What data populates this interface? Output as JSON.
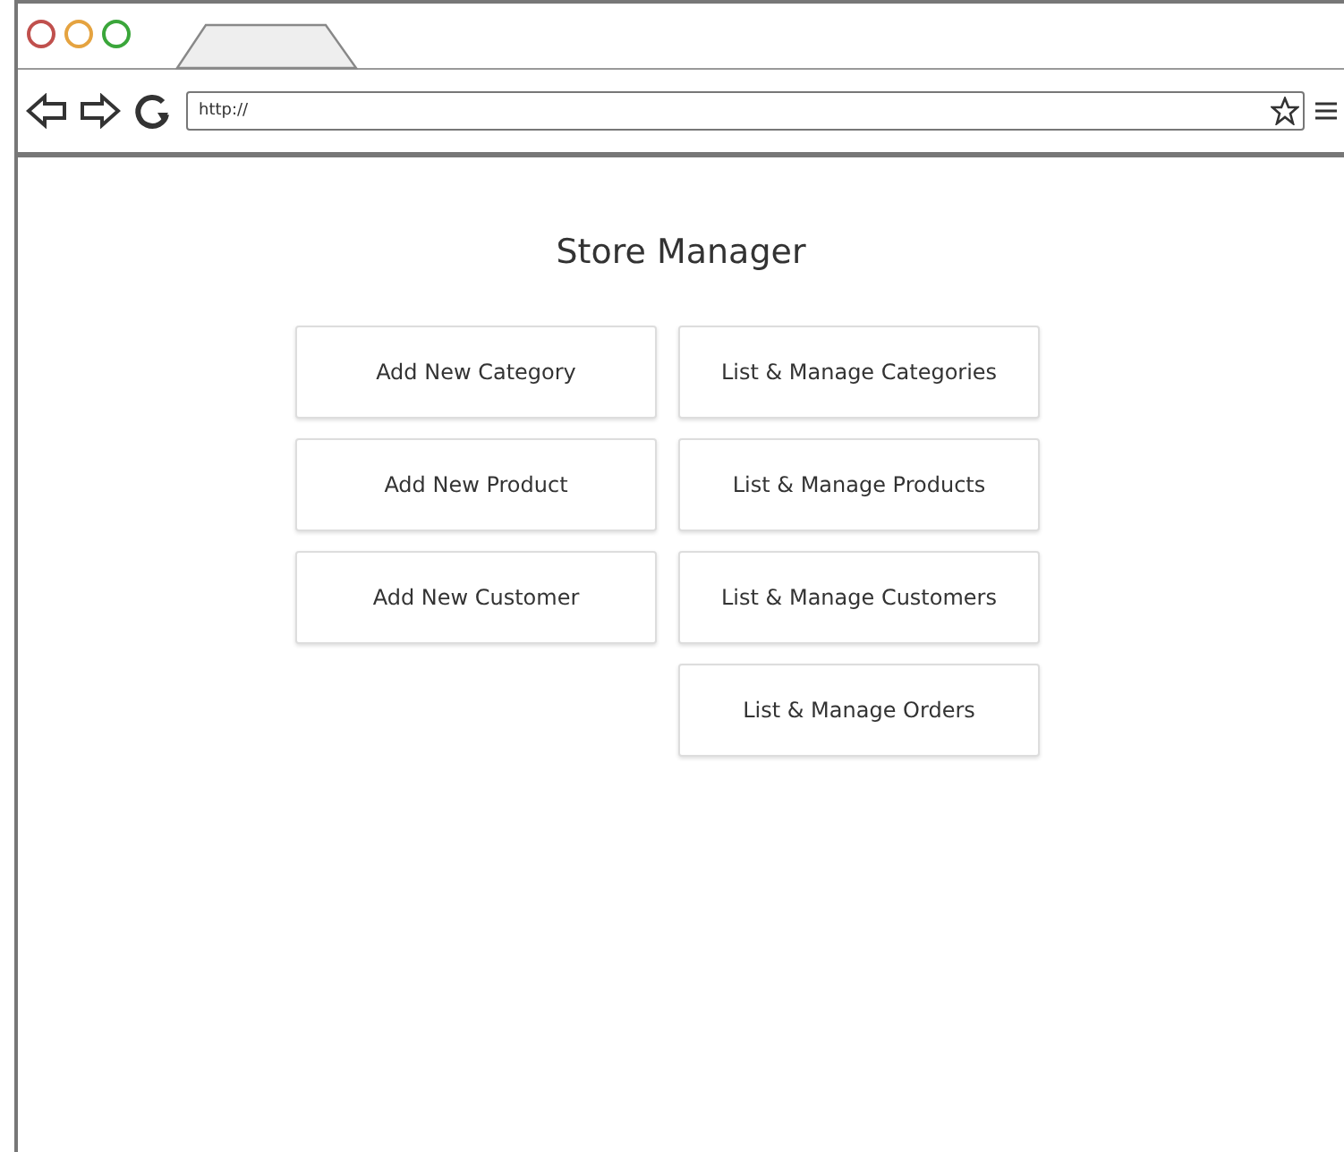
{
  "browser": {
    "address": "http://"
  },
  "page": {
    "title": "Store Manager",
    "add_buttons": [
      "Add New Category",
      "Add New Product",
      "Add New Customer"
    ],
    "manage_buttons": [
      "List & Manage Categories",
      "List & Manage Products",
      "List & Manage Customers",
      "List & Manage Orders"
    ]
  }
}
